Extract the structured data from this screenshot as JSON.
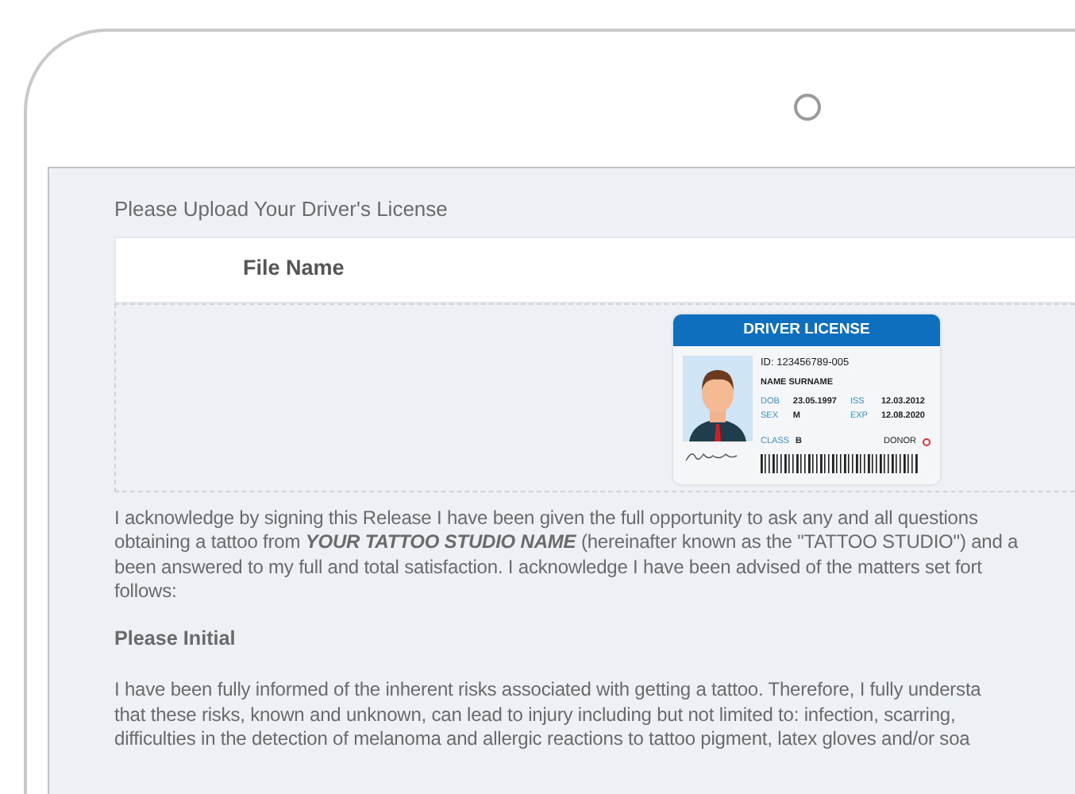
{
  "upload": {
    "label": "Please Upload Your Driver's License",
    "column_header": "File Name",
    "license": {
      "header": "DRIVER LICENSE",
      "id": "ID: 123456789-005",
      "name": "NAME SURNAME",
      "fields": [
        {
          "label": "DOB",
          "value": "23.05.1997"
        },
        {
          "label": "ISS",
          "value": "12.03.2012"
        },
        {
          "label": "SEX",
          "value": "M"
        },
        {
          "label": "EXP",
          "value": "12.08.2020"
        }
      ],
      "class_label": "CLASS",
      "class_value": "B",
      "donor": "DONOR"
    }
  },
  "paragraphs": [
    {
      "kind": "text",
      "lines": [
        "I acknowledge by signing this Release I have been given the full opportunity to ask any and all questions",
        "obtaining a tattoo from **YOUR TATTOO STUDIO NAME** (hereinafter known as the \"TATTOO STUDIO\") and a",
        "been answered to my full and total satisfaction. I acknowledge I have been advised of the matters set fort",
        "follows:"
      ]
    },
    {
      "kind": "heading",
      "lines": [
        "Please Initial"
      ]
    },
    {
      "kind": "text",
      "lines": [
        "I have been fully informed of the inherent risks associated with getting a tattoo. Therefore, I fully understa",
        "that these risks, known and unknown, can lead to injury including but not limited to: infection, scarring,",
        "difficulties in the detection of melanoma and allergic reactions to tattoo pigment, latex gloves and/or soa"
      ]
    }
  ]
}
